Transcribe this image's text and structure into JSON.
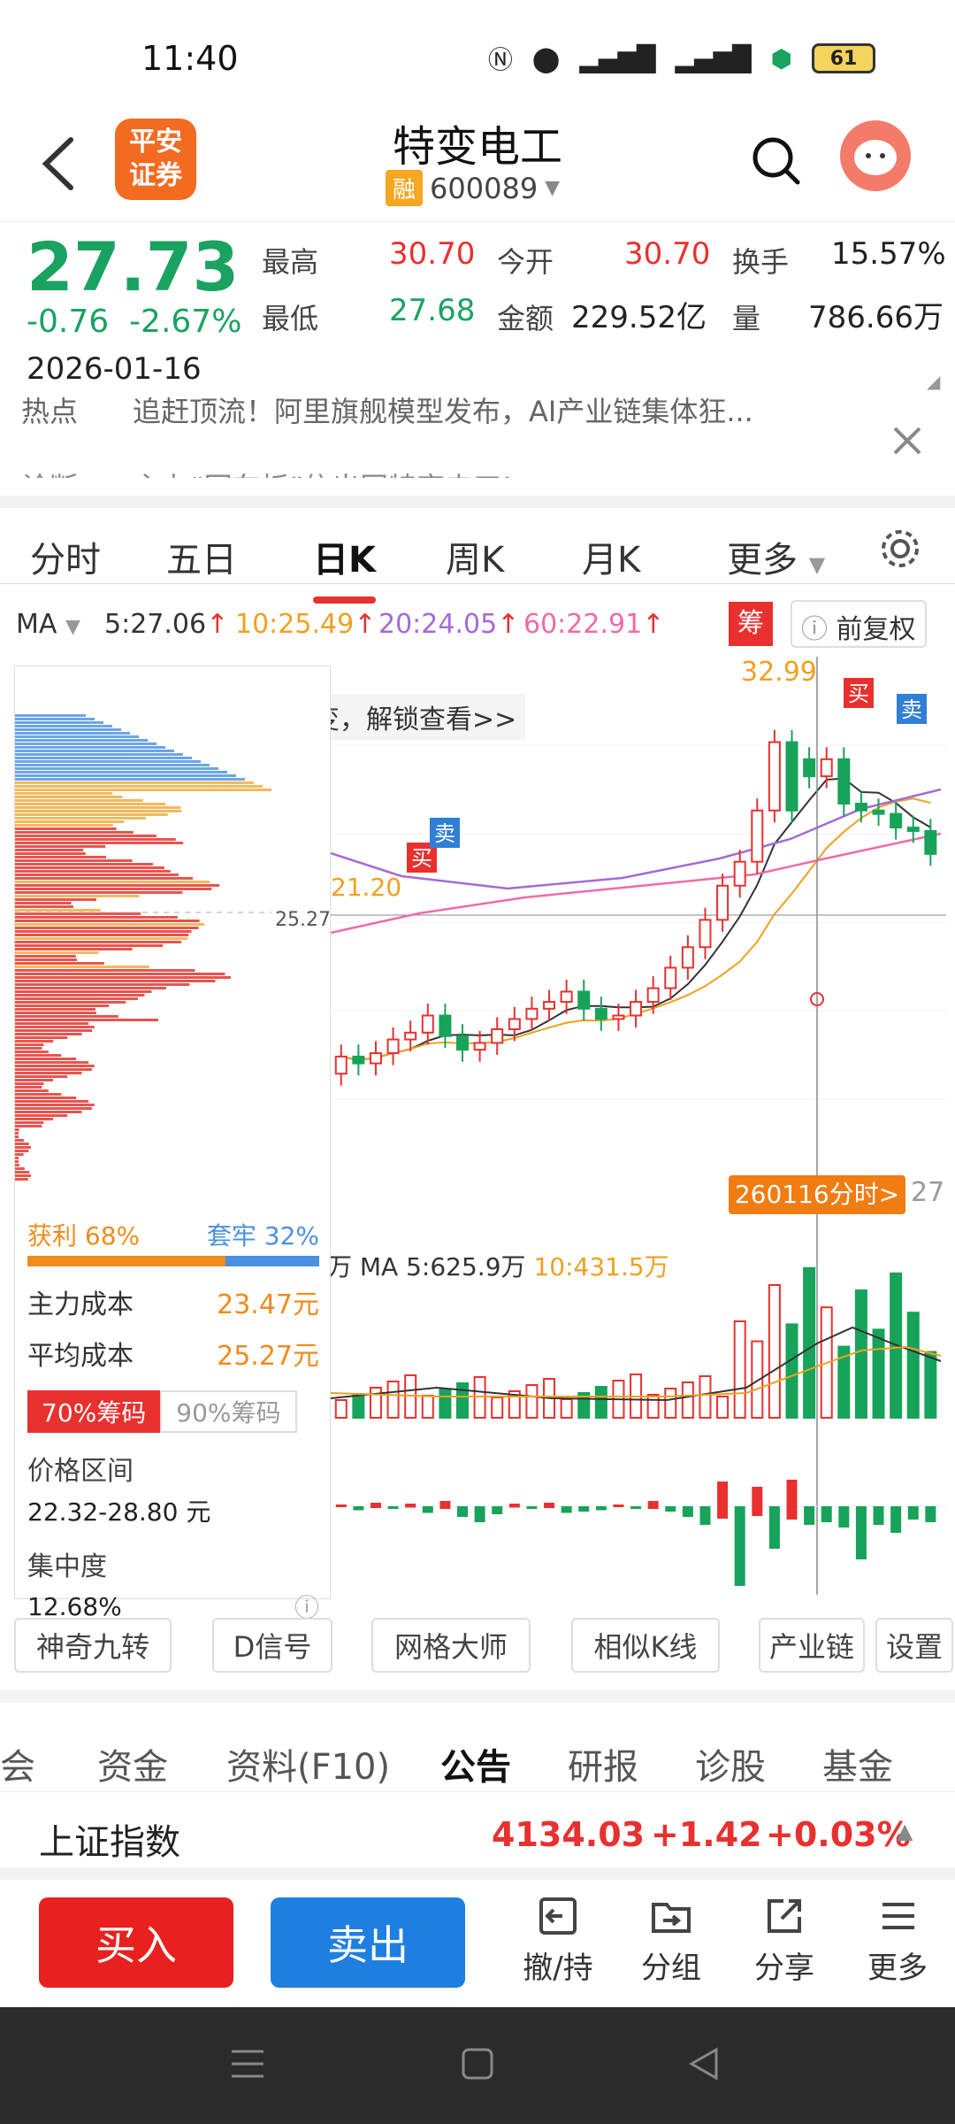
{
  "status": {
    "time": "11:40",
    "battery": "61"
  },
  "header": {
    "brand_line1": "平安",
    "brand_line2": "证券",
    "title": "特变电工",
    "tag": "融",
    "code": "600089"
  },
  "quote": {
    "price": "27.73",
    "change": "-0.76",
    "change_pct": "-2.67%",
    "date": "2026-01-16",
    "high_label": "最高",
    "high": "30.70",
    "open_label": "今开",
    "open": "30.70",
    "turnover_label": "换手",
    "turnover": "15.57%",
    "low_label": "最低",
    "low": "27.68",
    "amount_label": "金额",
    "amount": "229.52亿",
    "volume_label": "量",
    "volume": "786.66万"
  },
  "news": {
    "hot_label": "热点",
    "hot_text": "追赶顶流！阿里旗舰模型发布，AI产业链集体狂...",
    "diag_label": "诊断",
    "diag_text": "主力“回车板”信出固特变电工!"
  },
  "ktabs": [
    "分时",
    "五日",
    "日K",
    "周K",
    "月K",
    "更多"
  ],
  "ma": {
    "label": "MA",
    "ma5": "5:27.06",
    "ma10": "10:25.49",
    "ma20": "20:24.05",
    "ma60": "60:22.91",
    "chip_badge": "筹",
    "adjust": "前复权",
    "colors": {
      "ma5": "#333333",
      "ma10": "#f0a020",
      "ma20": "#a46ad6",
      "ma60": "#ef6aa8"
    }
  },
  "chip": {
    "profit": "获利 68%",
    "trapped": "套牢 32%",
    "main_cost_label": "主力成本",
    "main_cost": "23.47元",
    "avg_cost_label": "平均成本",
    "avg_cost": "25.27元",
    "tab70": "70%筹码",
    "tab90": "90%筹码",
    "range_label": "价格区间",
    "range": "22.32-28.80 元",
    "conc_label": "集中度",
    "conc": "12.68%",
    "price_mark": "25.27"
  },
  "chart": {
    "high_mark": "32.99",
    "unlock": "变，解锁查看>>",
    "buy": "买",
    "sell": "卖",
    "low_mark": "21.20",
    "popup": "260116分时>",
    "popup_price": "27",
    "vol_label": "万 MA 5:625.9万",
    "vol_ma10": "10:431.5万"
  },
  "chart_data": {
    "type": "candlestick",
    "note": "daily K bars, approximate",
    "open": [
      21.3,
      21.8,
      21.6,
      21.9,
      22.3,
      22.5,
      23.0,
      22.4,
      22.0,
      22.2,
      22.6,
      22.9,
      23.2,
      23.4,
      23.7,
      23.2,
      22.9,
      23.0,
      23.4,
      23.8,
      24.4,
      25.0,
      25.8,
      26.8,
      27.5,
      29.0,
      31.0,
      30.5,
      30.0,
      30.5,
      29.2,
      29.0,
      28.9,
      28.5,
      28.4
    ],
    "close": [
      21.8,
      21.6,
      21.9,
      22.3,
      22.5,
      23.0,
      22.4,
      22.0,
      22.2,
      22.6,
      22.9,
      23.2,
      23.4,
      23.7,
      23.2,
      22.9,
      23.0,
      23.4,
      23.8,
      24.4,
      25.0,
      25.8,
      26.8,
      27.5,
      29.0,
      31.0,
      29.0,
      30.0,
      30.5,
      29.2,
      29.0,
      28.9,
      28.5,
      28.4,
      27.73
    ],
    "ylim": [
      19,
      33.5
    ]
  },
  "tools": [
    "神奇九转",
    "D信号",
    "网格大师",
    "相似K线",
    "产业链",
    "设置"
  ],
  "sectabs": [
    "会",
    "资金",
    "资料(F10)",
    "公告",
    "研报",
    "诊股",
    "基金"
  ],
  "index": {
    "name": "上证指数",
    "value": "4134.03",
    "change": "+1.42",
    "pct": "+0.03%"
  },
  "actions": {
    "buy": "买入",
    "sell": "卖出",
    "hold": "撤/持",
    "group": "分组",
    "share": "分享",
    "more": "更多"
  }
}
